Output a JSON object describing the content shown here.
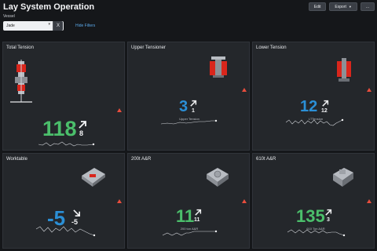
{
  "header": {
    "title": "Lay System Operation",
    "edit_label": "Edit",
    "export_label": "Export",
    "more_label": "..."
  },
  "filter": {
    "label": "Vessel",
    "value": "Jade",
    "clear_label": "X",
    "hide_label": "Hide Filters"
  },
  "panels": [
    {
      "title": "Total Tension",
      "value": "118",
      "delta": "8",
      "direction": "up",
      "sublabel": "",
      "color": "#4bbf6b"
    },
    {
      "title": "Upper Tensioner",
      "value": "3",
      "delta": "1",
      "direction": "up",
      "sublabel": "Upper Tension",
      "color": "#2b8fd6"
    },
    {
      "title": "Lower Tension",
      "value": "12",
      "delta": "12",
      "direction": "up",
      "sublabel": "LTTension",
      "color": "#2b8fd6"
    },
    {
      "title": "Worktable",
      "value": "-5",
      "delta": "-5",
      "direction": "down",
      "sublabel": "",
      "color": "#2b8fd6"
    },
    {
      "title": "200t A&R",
      "value": "11",
      "delta": "11",
      "direction": "up",
      "sublabel": "200 ton A&R",
      "color": "#4bbf6b"
    },
    {
      "title": "610t A&R",
      "value": "135",
      "delta": "3",
      "direction": "up",
      "sublabel": "610 Ton A&R",
      "color": "#4bbf6b"
    }
  ],
  "colors": {
    "green": "#4bbf6b",
    "blue": "#2b8fd6",
    "warning": "#e84d3d",
    "equipment_red": "#d9261c",
    "equipment_gray": "#b8bcc2"
  }
}
